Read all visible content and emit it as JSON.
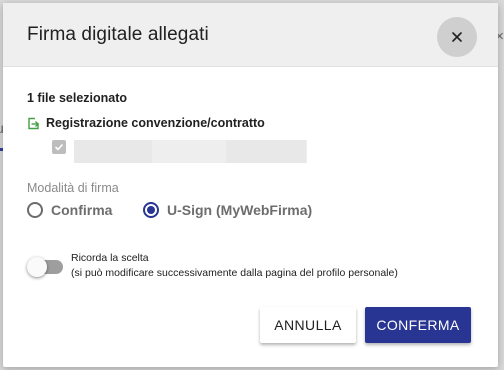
{
  "background": {
    "partial_text_left": "u",
    "partial_close": "×"
  },
  "dialog": {
    "title": "Firma digitale allegati",
    "close_glyph": "×",
    "files_count": "1 file selezionato",
    "file_group_label": "Registrazione convenzione/contratto",
    "mode_label": "Modalità di firma",
    "options": [
      {
        "label": "Confirma",
        "selected": false
      },
      {
        "label": "U-Sign (MyWebFirma)",
        "selected": true
      }
    ],
    "remember": {
      "title": "Ricorda la scelta",
      "description": "(si può modificare successivamente dalla pagina del profilo personale)",
      "enabled": false
    },
    "buttons": {
      "cancel": "ANNULLA",
      "confirm": "CONFERMA"
    }
  },
  "colors": {
    "primary": "#283593",
    "accent_green": "#43a047",
    "header_bg": "#efefef"
  },
  "icons": [
    "close-icon",
    "file-export-icon",
    "check-icon"
  ]
}
